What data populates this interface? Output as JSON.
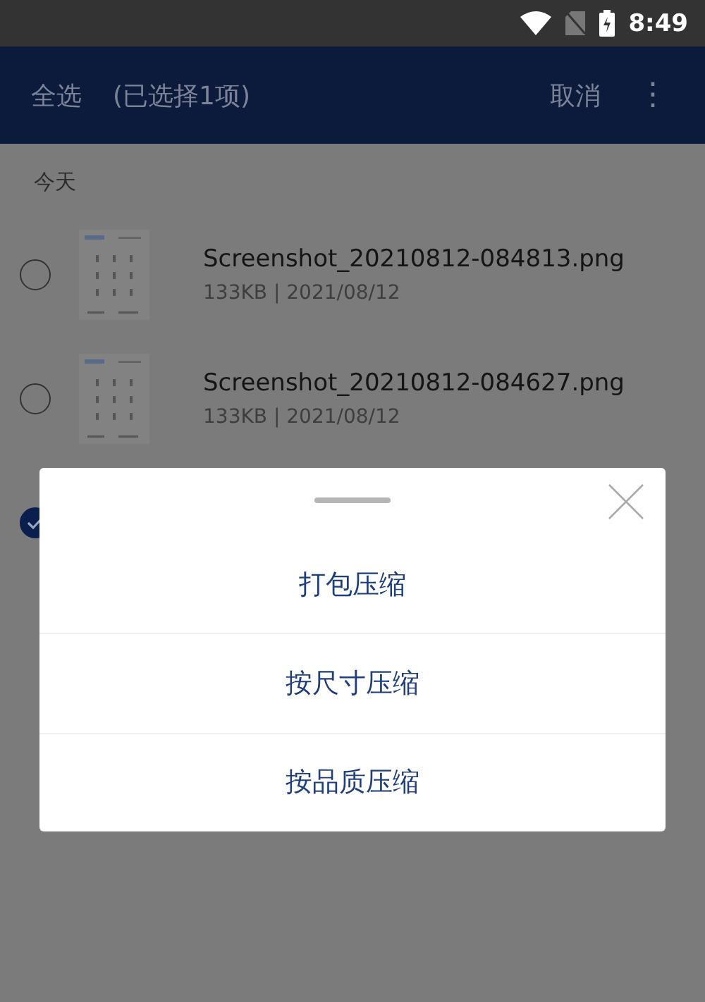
{
  "status_bar": {
    "time": "8:49"
  },
  "app_bar": {
    "select_all": "全选",
    "selection_count": "(已选择1项)",
    "cancel": "取消",
    "more": "⋮"
  },
  "section": "今天",
  "files": [
    {
      "name": "Screenshot_20210812-084813.png",
      "meta": "133KB | 2021/08/12",
      "selected": false
    },
    {
      "name": "Screenshot_20210812-084627.png",
      "meta": "133KB | 2021/08/12",
      "selected": false
    },
    {
      "selected": true
    }
  ],
  "sheet": {
    "options": [
      "打包压缩",
      "按尺寸压缩",
      "按品质压缩"
    ]
  }
}
